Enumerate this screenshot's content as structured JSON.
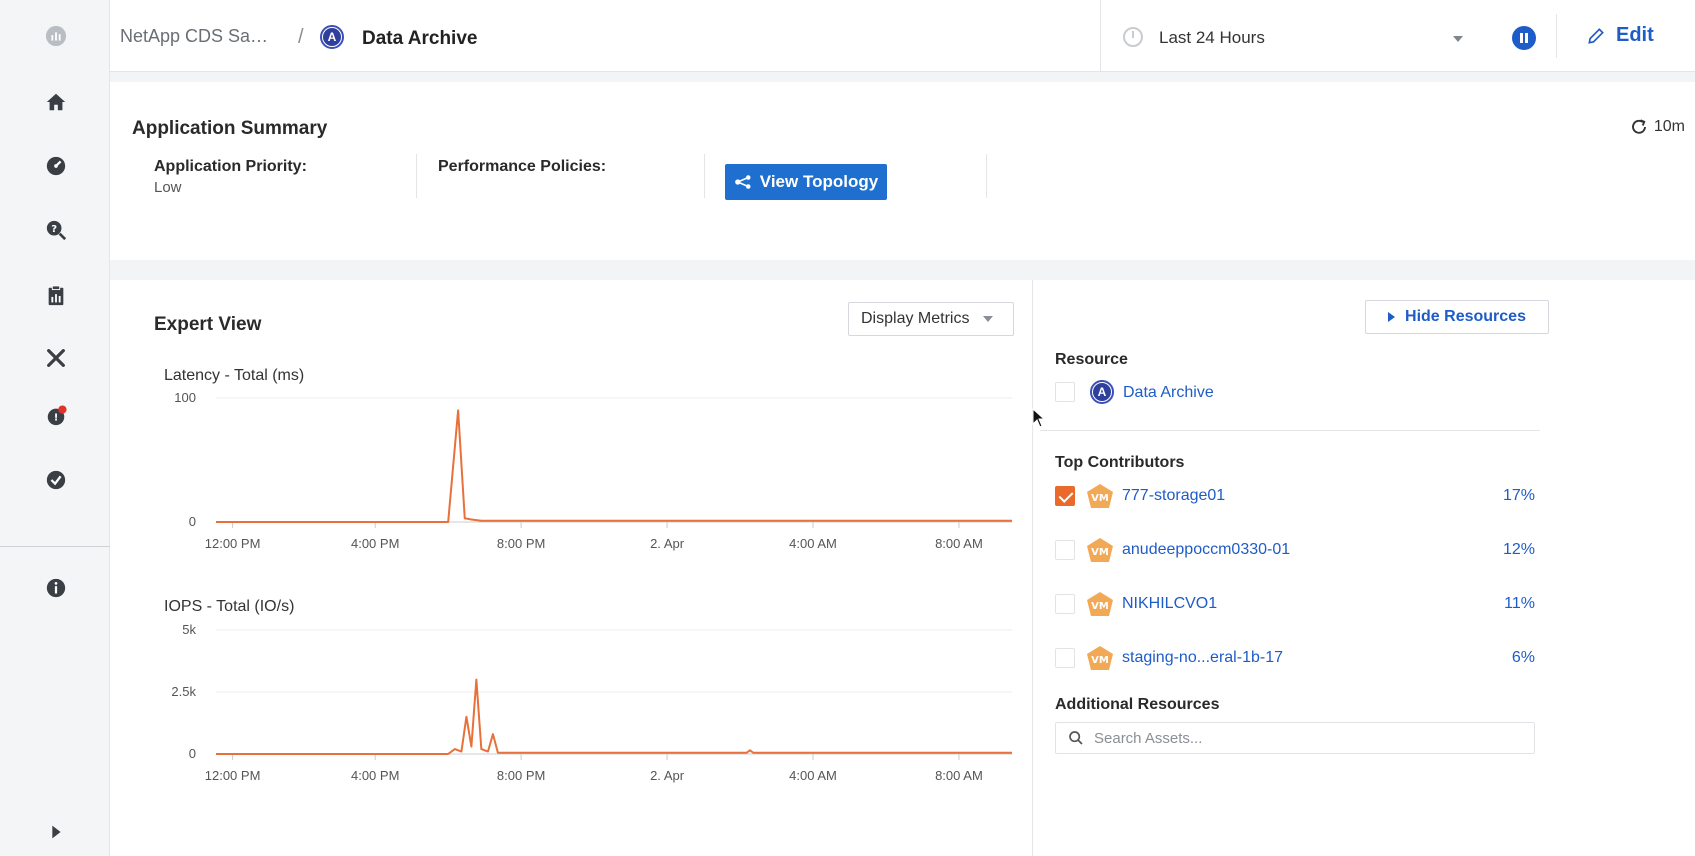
{
  "header": {
    "breadcrumb_parent": "NetApp CDS Sa…",
    "separator": "/",
    "app_badge": "A",
    "breadcrumb_current": "Data Archive",
    "time_range": "Last 24 Hours",
    "edit_label": "Edit"
  },
  "sidebar": {
    "items": [
      {
        "icon": "logo-icon"
      },
      {
        "icon": "home-icon"
      },
      {
        "icon": "dashboard-icon"
      },
      {
        "icon": "query-icon"
      },
      {
        "icon": "clipboard-icon"
      },
      {
        "icon": "tools-icon"
      },
      {
        "icon": "alerts-icon"
      },
      {
        "icon": "shield-icon"
      },
      {
        "icon": "info-icon"
      },
      {
        "icon": "expand-icon"
      }
    ]
  },
  "summary": {
    "title": "Application Summary",
    "refresh": "10m",
    "priority_label": "Application Priority:",
    "priority_value": "Low",
    "policies_label": "Performance Policies:",
    "topology_button": "View Topology"
  },
  "expert_view": {
    "title": "Expert View",
    "display_metrics": "Display Metrics",
    "hide_resources": "Hide Resources"
  },
  "resources": {
    "resource_title": "Resource",
    "resource_badge": "A",
    "resource_name": "Data Archive",
    "top_title": "Top Contributors",
    "contributors": [
      {
        "name": "777-storage01",
        "pct": "17%",
        "checked": true
      },
      {
        "name": "anudeeppoccm0330-01",
        "pct": "12%",
        "checked": false
      },
      {
        "name": "NIKHILCVO1",
        "pct": "11%",
        "checked": false
      },
      {
        "name": "staging-no...eral-1b-17",
        "pct": "6%",
        "checked": false
      }
    ],
    "vm_label": "VM",
    "additional_title": "Additional Resources",
    "search_placeholder": "Search Assets..."
  },
  "chart_data": [
    {
      "type": "line",
      "title": "Latency - Total (ms)",
      "y_ticks": [
        "100",
        "0"
      ],
      "ylim": [
        0,
        100
      ],
      "x_ticks": [
        "12:00 PM",
        "4:00 PM",
        "8:00 PM",
        "2. Apr",
        "4:00 AM",
        "8:00 AM"
      ],
      "series": [
        {
          "color": "#e8703a",
          "x": [
            0,
            7,
            7.3,
            7.5,
            7.7,
            8,
            9,
            10,
            24
          ],
          "y": [
            0,
            0,
            90,
            3,
            2,
            1,
            1,
            1,
            1
          ]
        }
      ]
    },
    {
      "type": "line",
      "title": "IOPS - Total (IO/s)",
      "y_ticks": [
        "5k",
        "2.5k",
        "0"
      ],
      "ylim": [
        0,
        5000
      ],
      "x_ticks": [
        "12:00 PM",
        "4:00 PM",
        "8:00 PM",
        "2. Apr",
        "4:00 AM",
        "8:00 AM"
      ],
      "series": [
        {
          "color": "#e8703a",
          "x": [
            0,
            7,
            7.2,
            7.4,
            7.55,
            7.7,
            7.85,
            8,
            8.2,
            8.35,
            8.5,
            9,
            16,
            16.1,
            16.2,
            24
          ],
          "y": [
            0,
            0,
            200,
            100,
            1500,
            300,
            3000,
            200,
            100,
            800,
            50,
            50,
            50,
            150,
            50,
            50
          ]
        }
      ]
    }
  ]
}
